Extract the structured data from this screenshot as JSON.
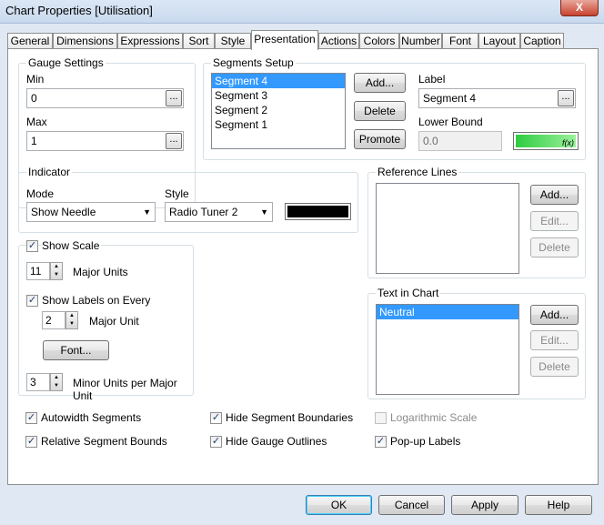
{
  "window": {
    "title": "Chart Properties [Utilisation]",
    "close_glyph": "X"
  },
  "tabs": [
    "General",
    "Dimensions",
    "Expressions",
    "Sort",
    "Style",
    "Presentation",
    "Actions",
    "Colors",
    "Number",
    "Font",
    "Layout",
    "Caption"
  ],
  "active_tab": "Presentation",
  "gauge": {
    "legend": "Gauge Settings",
    "min_label": "Min",
    "min_value": "0",
    "max_label": "Max",
    "max_value": "1",
    "dots": "..."
  },
  "segments": {
    "legend": "Segments Setup",
    "items": [
      "Segment 4",
      "Segment 3",
      "Segment 2",
      "Segment 1"
    ],
    "add": "Add...",
    "delete": "Delete",
    "promote": "Promote",
    "label_caption": "Label",
    "label_value": "Segment 4",
    "lower_bound_caption": "Lower Bound",
    "lower_bound_value": "0.0",
    "color": "#2ecc40",
    "fx": "f(x)"
  },
  "indicator": {
    "legend": "Indicator",
    "mode_label": "Mode",
    "mode_value": "Show Needle",
    "style_label": "Style",
    "style_value": "Radio Tuner 2",
    "color": "#000000"
  },
  "reference_lines": {
    "legend": "Reference Lines",
    "add": "Add...",
    "edit": "Edit...",
    "delete": "Delete"
  },
  "scale": {
    "show_scale": "Show Scale",
    "major_units_value": "11",
    "major_units_label": "Major Units",
    "show_labels": "Show Labels on Every",
    "labels_every_value": "2",
    "labels_every_label": "Major Unit",
    "font_button": "Font...",
    "minor_units_value": "3",
    "minor_units_label": "Minor Units per Major Unit"
  },
  "text_in_chart": {
    "legend": "Text in Chart",
    "items": [
      "Neutral"
    ],
    "add": "Add...",
    "edit": "Edit...",
    "delete": "Delete"
  },
  "options": {
    "autowidth": "Autowidth Segments",
    "relative_bounds": "Relative Segment Bounds",
    "hide_boundaries": "Hide Segment Boundaries",
    "hide_outlines": "Hide Gauge Outlines",
    "log_scale": "Logarithmic Scale",
    "popup_labels": "Pop-up Labels"
  },
  "footer": {
    "ok": "OK",
    "cancel": "Cancel",
    "apply": "Apply",
    "help": "Help"
  },
  "check_glyph": "✓"
}
